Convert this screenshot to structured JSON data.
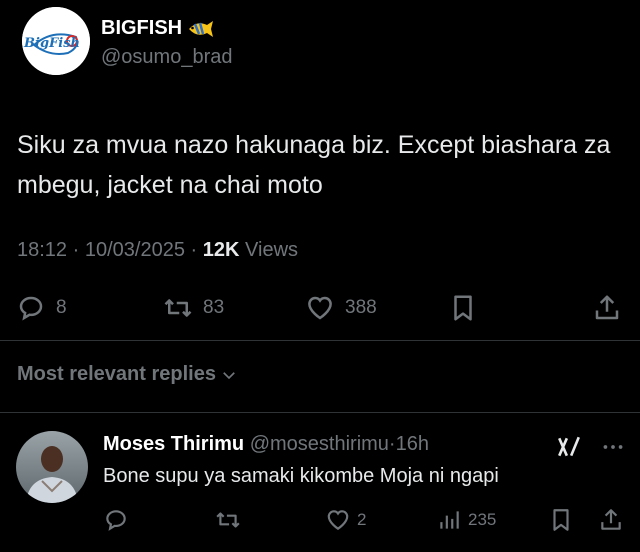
{
  "tweet": {
    "author": {
      "display_name": "BIGFISH",
      "handle": "@osumo_brad",
      "avatar_logo_text": "BigFish",
      "name_emoji": "fish-icon"
    },
    "text": "Siku za mvua nazo hakunaga biz. Except biashara za mbegu, jacket na chai moto",
    "time": "18:12",
    "date": "10/03/2025",
    "separator": "·",
    "views_count": "12K",
    "views_label": "Views",
    "actions": {
      "replies": "8",
      "retweets": "83",
      "likes": "388"
    }
  },
  "replies_filter": {
    "label": "Most relevant replies"
  },
  "reply": {
    "display_name": "Moses Thirimu",
    "handle": "@mosesthirimu",
    "age": "16h",
    "text": "Bone supu ya samaki kikombe Moja ni ngapi",
    "actions": {
      "likes": "2",
      "views": "235"
    }
  },
  "colors": {
    "background": "#000000",
    "text": "#e7e9ea",
    "muted": "#71767b",
    "divider": "#2f3336"
  }
}
